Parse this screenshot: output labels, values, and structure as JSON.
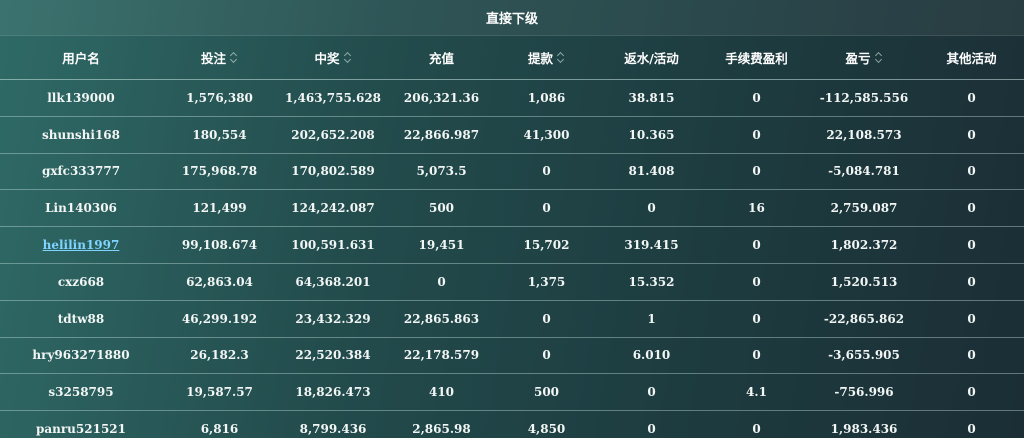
{
  "title": "直接下级",
  "columns": [
    "用户名",
    "投注",
    "中奖",
    "充值",
    "提款",
    "返水/活动",
    "手续费盈利",
    "盈亏",
    "其他活动"
  ],
  "sortable": [
    false,
    true,
    true,
    false,
    true,
    false,
    false,
    true,
    false
  ],
  "rows": [
    {
      "user": "llk139000",
      "link": false,
      "cells": [
        "1,576,380",
        "1,463,755.628",
        "206,321.36",
        "1,086",
        "38.815",
        "0",
        "-112,585.556",
        "0"
      ]
    },
    {
      "user": "shunshi168",
      "link": false,
      "cells": [
        "180,554",
        "202,652.208",
        "22,866.987",
        "41,300",
        "10.365",
        "0",
        "22,108.573",
        "0"
      ]
    },
    {
      "user": "gxfc333777",
      "link": false,
      "cells": [
        "175,968.78",
        "170,802.589",
        "5,073.5",
        "0",
        "81.408",
        "0",
        "-5,084.781",
        "0"
      ]
    },
    {
      "user": "Lin140306",
      "link": false,
      "cells": [
        "121,499",
        "124,242.087",
        "500",
        "0",
        "0",
        "16",
        "2,759.087",
        "0"
      ]
    },
    {
      "user": "helilin1997",
      "link": true,
      "cells": [
        "99,108.674",
        "100,591.631",
        "19,451",
        "15,702",
        "319.415",
        "0",
        "1,802.372",
        "0"
      ]
    },
    {
      "user": "cxz668",
      "link": false,
      "cells": [
        "62,863.04",
        "64,368.201",
        "0",
        "1,375",
        "15.352",
        "0",
        "1,520.513",
        "0"
      ]
    },
    {
      "user": "tdtw88",
      "link": false,
      "cells": [
        "46,299.192",
        "23,432.329",
        "22,865.863",
        "0",
        "1",
        "0",
        "-22,865.862",
        "0"
      ]
    },
    {
      "user": "hry963271880",
      "link": false,
      "cells": [
        "26,182.3",
        "22,520.384",
        "22,178.579",
        "0",
        "6.010",
        "0",
        "-3,655.905",
        "0"
      ]
    },
    {
      "user": "s3258795",
      "link": false,
      "cells": [
        "19,587.57",
        "18,826.473",
        "410",
        "500",
        "0",
        "4.1",
        "-756.996",
        "0"
      ]
    },
    {
      "user": "panru521521",
      "link": false,
      "cells": [
        "6,816",
        "8,799.436",
        "2,865.98",
        "4,850",
        "0",
        "0",
        "1,983.436",
        "0"
      ]
    }
  ]
}
